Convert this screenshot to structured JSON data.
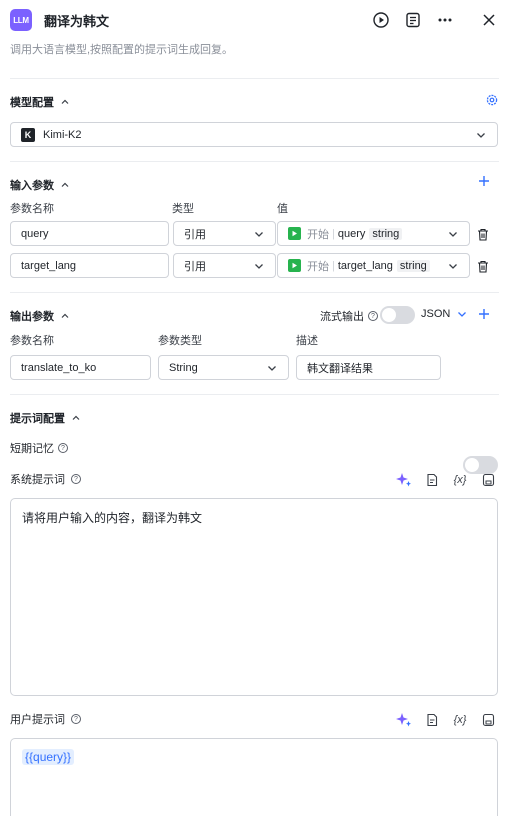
{
  "header": {
    "logo_text": "LLM",
    "title": "翻译为韩文",
    "description": "调用大语言模型,按照配置的提示词生成回复。"
  },
  "model_section": {
    "title": "模型配置",
    "selected_model": "Kimi-K2"
  },
  "input_section": {
    "title": "输入参数",
    "col_name": "参数名称",
    "col_type": "类型",
    "col_value": "值",
    "rows": [
      {
        "name": "query",
        "type": "引用",
        "source": "开始",
        "var": "query",
        "var_type": "string"
      },
      {
        "name": "target_lang",
        "type": "引用",
        "source": "开始",
        "var": "target_lang",
        "var_type": "string"
      }
    ]
  },
  "output_section": {
    "title": "输出参数",
    "stream_label": "流式输出",
    "format": "JSON",
    "col_name": "参数名称",
    "col_type": "参数类型",
    "col_desc": "描述",
    "row": {
      "name": "translate_to_ko",
      "type": "String",
      "desc": "韩文翻译结果"
    }
  },
  "prompt_section": {
    "title": "提示词配置",
    "memory_label": "短期记忆",
    "system_label": "系统提示词",
    "system_prompt": "请将用户输入的内容，翻译为韩文",
    "user_label": "用户提示词",
    "user_prompt_var": "{{query}}",
    "var_icon_text": "{x}"
  },
  "colors": {
    "accent": "#3370ff",
    "logo_bg": "#7b61ff",
    "start_green": "#27b34e"
  },
  "icons": [
    "play-icon",
    "document-icon",
    "more-icon",
    "close-icon",
    "settings-icon",
    "sparkle-icon",
    "template-icon",
    "variable-icon",
    "save-icon",
    "trash-icon",
    "chevron-down-icon",
    "chevron-up-icon",
    "help-icon",
    "plus-icon",
    "kimi-logo-icon"
  ]
}
